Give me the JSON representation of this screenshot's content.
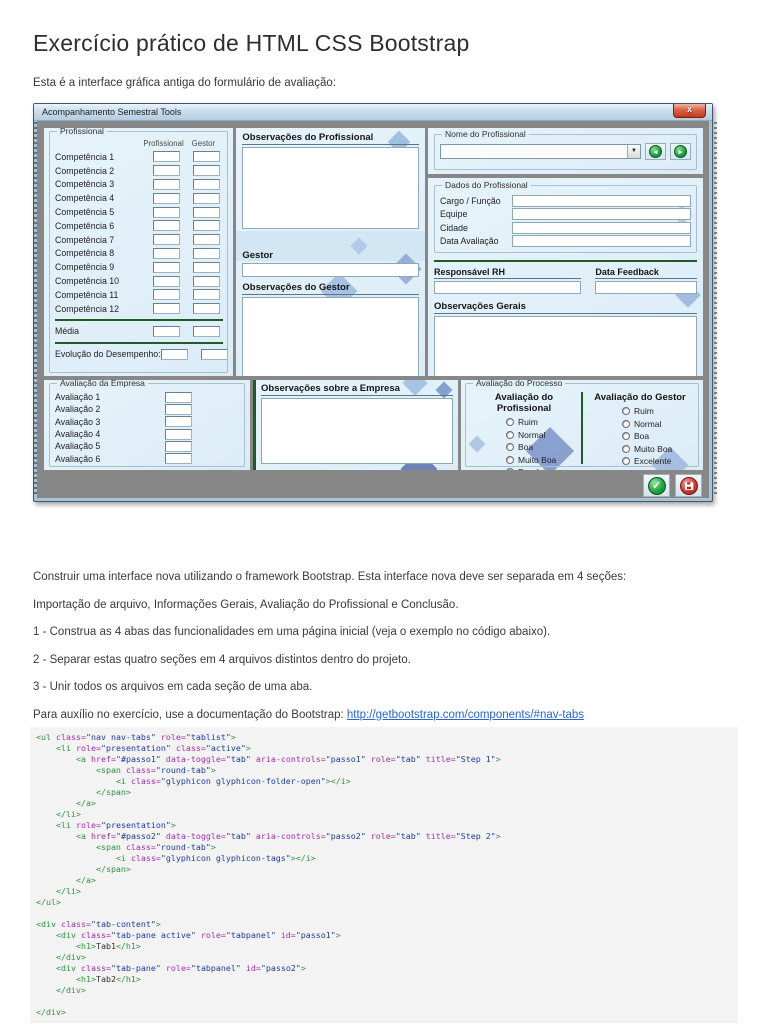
{
  "page": {
    "title": "Exercício prático de HTML CSS Bootstrap",
    "subtitle": "Esta é a interface gráfica antiga do formulário de avaliação:"
  },
  "icons": {
    "close": "x",
    "dropdown": "▼",
    "prev": "◄",
    "next": "►",
    "check": "✓"
  },
  "app": {
    "window_title": "Acompanhamento Semestral Tools",
    "profissional_group": {
      "title": "Profissional",
      "col_headers": [
        "Profissional",
        "Gestor"
      ],
      "rows": [
        "Competência 1",
        "Competência 2",
        "Competência 3",
        "Competência 4",
        "Competência 5",
        "Competência 6",
        "Competência 7",
        "Competência 8",
        "Competência 9",
        "Competência 10",
        "Competência 11",
        "Competência 12"
      ],
      "media_label": "Média",
      "evolucao_label": "Evolução do Desempenho:"
    },
    "obs_profissional_title": "Observações do Profissional",
    "gestor_label": "Gestor",
    "obs_gestor_title": "Observações do Gestor",
    "nome_group_title": "Nome do Profissional",
    "dados_group": {
      "title": "Dados do Profissional",
      "fields": [
        "Cargo / Função",
        "Equipe",
        "Cidade",
        "Data Avaliação"
      ]
    },
    "responsavel_label": "Responsável RH",
    "data_feedback_label": "Data Feedback",
    "obs_gerais_title": "Observações Gerais",
    "avaliacao_empresa": {
      "title": "Avaliação da Empresa",
      "rows": [
        "Avaliação 1",
        "Avaliação 2",
        "Avaliação 3",
        "Avaliação 4",
        "Avaliação 5",
        "Avaliação 6"
      ]
    },
    "obs_empresa_title": "Observações sobre a Empresa",
    "avaliacao_processo": {
      "title": "Avaliação do Processo",
      "columns": [
        {
          "title": "Avaliação do Profissional",
          "options": [
            "Ruim",
            "Normal",
            "Boa",
            "Muito Boa",
            "Excelente"
          ]
        },
        {
          "title": "Avaliação do Gestor",
          "options": [
            "Ruim",
            "Normal",
            "Boa",
            "Muito Boa",
            "Excelente"
          ]
        }
      ]
    }
  },
  "instructions": {
    "paragraphs": [
      "Construir uma interface nova utilizando o framework Bootstrap. Esta interface nova deve ser separada em 4 seções:",
      "Importação de arquivo, Informações Gerais, Avaliação do Profissional e Conclusão.",
      "1 -  Construa as 4 abas das funcionalidades em uma página inicial (veja o exemplo no código abaixo).",
      "2 -  Separar estas quatro seções em 4 arquivos distintos dentro do projeto.",
      "3 -  Unir todos os arquivos em cada seção de uma aba."
    ],
    "link_prefix": "Para auxílio no exercício, use a documentação do Bootstrap: ",
    "link_text": "http://getbootstrap.com/components/#nav-tabs"
  },
  "code": {
    "lines": [
      [
        [
          "g",
          "<ul"
        ],
        [
          "p",
          " "
        ],
        [
          "a",
          "class="
        ],
        [
          "v",
          "\"nav nav-tabs\""
        ],
        [
          "p",
          " "
        ],
        [
          "a",
          "role="
        ],
        [
          "v",
          "\"tablist\""
        ],
        [
          "g",
          ">"
        ]
      ],
      [
        [
          "p",
          "    "
        ],
        [
          "g",
          "<li"
        ],
        [
          "p",
          " "
        ],
        [
          "a",
          "role="
        ],
        [
          "v",
          "\"presentation\""
        ],
        [
          "p",
          " "
        ],
        [
          "a",
          "class="
        ],
        [
          "v",
          "\"active\""
        ],
        [
          "g",
          ">"
        ]
      ],
      [
        [
          "p",
          "        "
        ],
        [
          "g",
          "<a"
        ],
        [
          "p",
          " "
        ],
        [
          "a",
          "href="
        ],
        [
          "v",
          "\"#passo1\""
        ],
        [
          "p",
          " "
        ],
        [
          "a",
          "data-toggle="
        ],
        [
          "v",
          "\"tab\""
        ],
        [
          "p",
          " "
        ],
        [
          "a",
          "aria-controls="
        ],
        [
          "v",
          "\"passo1\""
        ],
        [
          "p",
          " "
        ],
        [
          "a",
          "role="
        ],
        [
          "v",
          "\"tab\""
        ],
        [
          "p",
          " "
        ],
        [
          "a",
          "title="
        ],
        [
          "v",
          "\"Step 1\""
        ],
        [
          "g",
          ">"
        ]
      ],
      [
        [
          "p",
          "            "
        ],
        [
          "g",
          "<span"
        ],
        [
          "p",
          " "
        ],
        [
          "a",
          "class="
        ],
        [
          "v",
          "\"round-tab\""
        ],
        [
          "g",
          ">"
        ]
      ],
      [
        [
          "p",
          "                "
        ],
        [
          "g",
          "<i"
        ],
        [
          "p",
          " "
        ],
        [
          "a",
          "class="
        ],
        [
          "v",
          "\"glyphicon glyphicon-folder-open\""
        ],
        [
          "g",
          "></i>"
        ]
      ],
      [
        [
          "p",
          "            "
        ],
        [
          "g",
          "</span>"
        ]
      ],
      [
        [
          "p",
          "        "
        ],
        [
          "g",
          "</a>"
        ]
      ],
      [
        [
          "p",
          "    "
        ],
        [
          "g",
          "</li>"
        ]
      ],
      [
        [
          "p",
          "    "
        ],
        [
          "g",
          "<li"
        ],
        [
          "p",
          " "
        ],
        [
          "a",
          "role="
        ],
        [
          "v",
          "\"presentation\""
        ],
        [
          "g",
          ">"
        ]
      ],
      [
        [
          "p",
          "        "
        ],
        [
          "g",
          "<a"
        ],
        [
          "p",
          " "
        ],
        [
          "a",
          "href="
        ],
        [
          "v",
          "\"#passo2\""
        ],
        [
          "p",
          " "
        ],
        [
          "a",
          "data-toggle="
        ],
        [
          "v",
          "\"tab\""
        ],
        [
          "p",
          " "
        ],
        [
          "a",
          "aria-controls="
        ],
        [
          "v",
          "\"passo2\""
        ],
        [
          "p",
          " "
        ],
        [
          "a",
          "role="
        ],
        [
          "v",
          "\"tab\""
        ],
        [
          "p",
          " "
        ],
        [
          "a",
          "title="
        ],
        [
          "v",
          "\"Step 2\""
        ],
        [
          "g",
          ">"
        ]
      ],
      [
        [
          "p",
          "            "
        ],
        [
          "g",
          "<span"
        ],
        [
          "p",
          " "
        ],
        [
          "a",
          "class="
        ],
        [
          "v",
          "\"round-tab\""
        ],
        [
          "g",
          ">"
        ]
      ],
      [
        [
          "p",
          "                "
        ],
        [
          "g",
          "<i"
        ],
        [
          "p",
          " "
        ],
        [
          "a",
          "class="
        ],
        [
          "v",
          "\"glyphicon glyphicon-tags\""
        ],
        [
          "g",
          "></i>"
        ]
      ],
      [
        [
          "p",
          "            "
        ],
        [
          "g",
          "</span>"
        ]
      ],
      [
        [
          "p",
          "        "
        ],
        [
          "g",
          "</a>"
        ]
      ],
      [
        [
          "p",
          "    "
        ],
        [
          "g",
          "</li>"
        ]
      ],
      [
        [
          "g",
          "</ul>"
        ]
      ],
      [],
      [
        [
          "g",
          "<div"
        ],
        [
          "p",
          " "
        ],
        [
          "a",
          "class="
        ],
        [
          "v",
          "\"tab-content\""
        ],
        [
          "g",
          ">"
        ]
      ],
      [
        [
          "p",
          "    "
        ],
        [
          "g",
          "<div"
        ],
        [
          "p",
          " "
        ],
        [
          "a",
          "class="
        ],
        [
          "v",
          "\"tab-pane active\""
        ],
        [
          "p",
          " "
        ],
        [
          "a",
          "role="
        ],
        [
          "v",
          "\"tabpanel\""
        ],
        [
          "p",
          " "
        ],
        [
          "a",
          "id="
        ],
        [
          "v",
          "\"passo1\""
        ],
        [
          "g",
          ">"
        ]
      ],
      [
        [
          "p",
          "        "
        ],
        [
          "g",
          "<h1>"
        ],
        [
          "p",
          "Tab1"
        ],
        [
          "g",
          "</h1>"
        ]
      ],
      [
        [
          "p",
          "    "
        ],
        [
          "g",
          "</div>"
        ]
      ],
      [
        [
          "p",
          "    "
        ],
        [
          "g",
          "<div"
        ],
        [
          "p",
          " "
        ],
        [
          "a",
          "class="
        ],
        [
          "v",
          "\"tab-pane\""
        ],
        [
          "p",
          " "
        ],
        [
          "a",
          "role="
        ],
        [
          "v",
          "\"tabpanel\""
        ],
        [
          "p",
          " "
        ],
        [
          "a",
          "id="
        ],
        [
          "v",
          "\"passo2\""
        ],
        [
          "g",
          ">"
        ]
      ],
      [
        [
          "p",
          "        "
        ],
        [
          "g",
          "<h1>"
        ],
        [
          "p",
          "Tab2"
        ],
        [
          "g",
          "</h1>"
        ]
      ],
      [
        [
          "p",
          "    "
        ],
        [
          "g",
          "</div>"
        ]
      ],
      [],
      [
        [
          "g",
          "</div>"
        ]
      ]
    ]
  }
}
